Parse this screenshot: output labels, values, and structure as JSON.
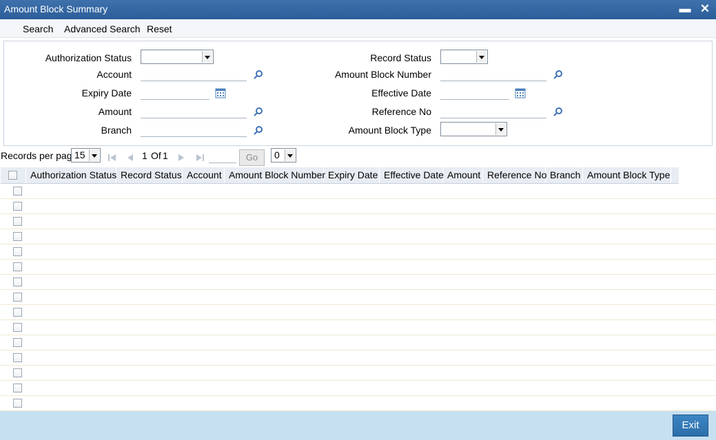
{
  "window": {
    "title": "Amount Block Summary",
    "minimize_symbol": "▬",
    "close_symbol": "✕"
  },
  "toolbar": {
    "search": "Search",
    "advanced_search": "Advanced Search",
    "reset": "Reset"
  },
  "criteria": {
    "authorization_status": "Authorization Status",
    "account": "Account",
    "expiry_date": "Expiry Date",
    "amount": "Amount",
    "branch": "Branch",
    "record_status": "Record Status",
    "amount_block_number": "Amount Block Number",
    "effective_date": "Effective Date",
    "reference_no": "Reference No",
    "amount_block_type": "Amount Block Type"
  },
  "pager": {
    "records_per_page_label": "Records per page",
    "records_per_page_value": "15",
    "page_current": "1",
    "page_of": "Of",
    "page_total": "1",
    "go_label": "Go",
    "extra_select_value": "0"
  },
  "grid": {
    "columns": [
      "Authorization Status",
      "Record Status",
      "Account",
      "Amount Block Number",
      "Expiry Date",
      "Effective Date",
      "Amount",
      "Reference No",
      "Branch",
      "Amount Block Type"
    ],
    "row_count": 15
  },
  "footer": {
    "exit_label": "Exit"
  },
  "colors": {
    "titlebar": "#2f64a0",
    "footer": "#c6dff1",
    "exit_button": "#3179b8",
    "search_icon": "#3d72b4"
  }
}
